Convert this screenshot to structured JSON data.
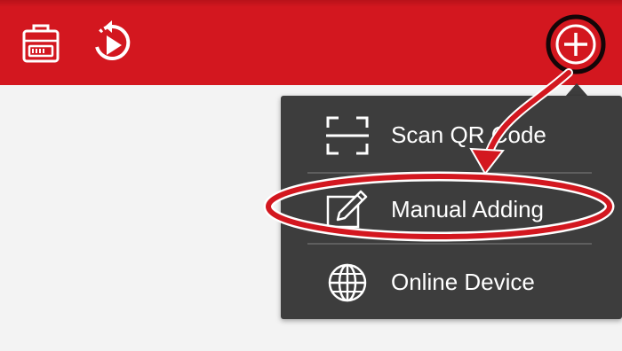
{
  "toolbar": {
    "device_icon": "device-list-icon",
    "playback_icon": "playback-icon",
    "add_icon": "add-icon",
    "bar_color": "#d3171f"
  },
  "menu": {
    "items": [
      {
        "label": "Scan QR Code",
        "icon": "qr-scan-icon"
      },
      {
        "label": "Manual Adding",
        "icon": "edit-icon"
      },
      {
        "label": "Online Device",
        "icon": "globe-icon"
      }
    ],
    "background": "#3d3d3d"
  },
  "annotation": {
    "color": "#d3171f",
    "highlight": "Manual Adding"
  }
}
